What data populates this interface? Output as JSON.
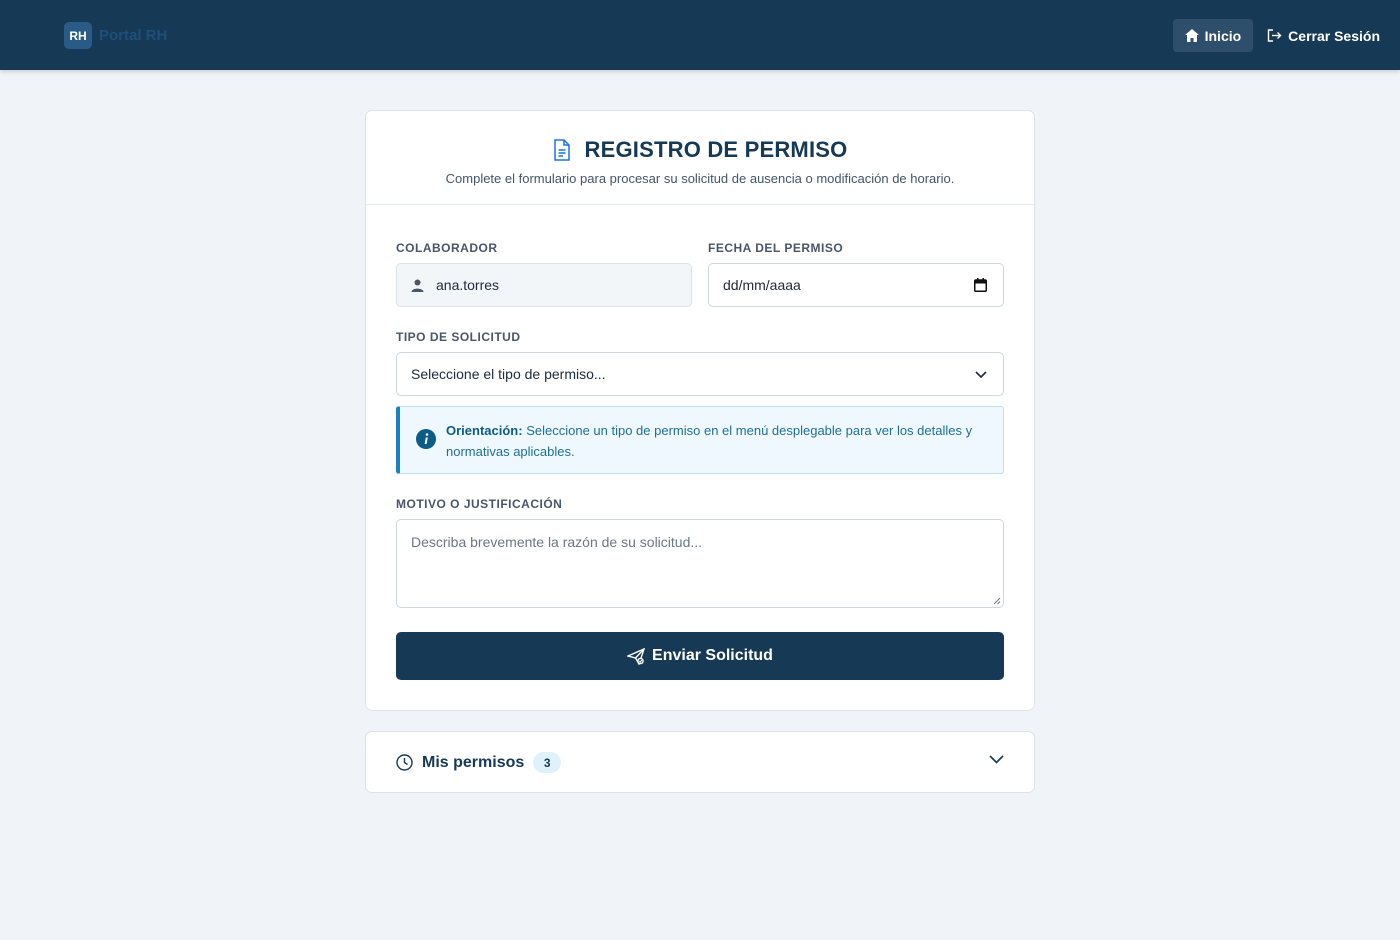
{
  "navbar": {
    "brand_badge": "RH",
    "brand_text": "Portal RH",
    "home_label": "Inicio",
    "logout_label": "Cerrar Sesión"
  },
  "form": {
    "title": "REGISTRO DE PERMISO",
    "subtitle": "Complete el formulario para procesar su solicitud de ausencia o modificación de horario.",
    "collaborator_label": "COLABORADOR",
    "collaborator_value": "ana.torres",
    "date_label": "FECHA DEL PERMISO",
    "date_value": "dd/mm/aaaa",
    "type_label": "TIPO DE SOLICITUD",
    "type_selected": "Seleccione el tipo de permiso...",
    "info_title": "Orientación:",
    "info_text": "Seleccione un tipo de permiso en el menú desplegable para ver los detalles y normativas aplicables.",
    "reason_label": "MOTIVO O JUSTIFICACIÓN",
    "reason_placeholder": "Describa brevemente la razón de su solicitud...",
    "submit_label": "Enviar Solicitud"
  },
  "permits": {
    "title": "Mis permisos",
    "count": "3"
  },
  "colors": {
    "primary": "#163956",
    "info_accent": "#1681c4",
    "background": "#f0f4f8"
  }
}
